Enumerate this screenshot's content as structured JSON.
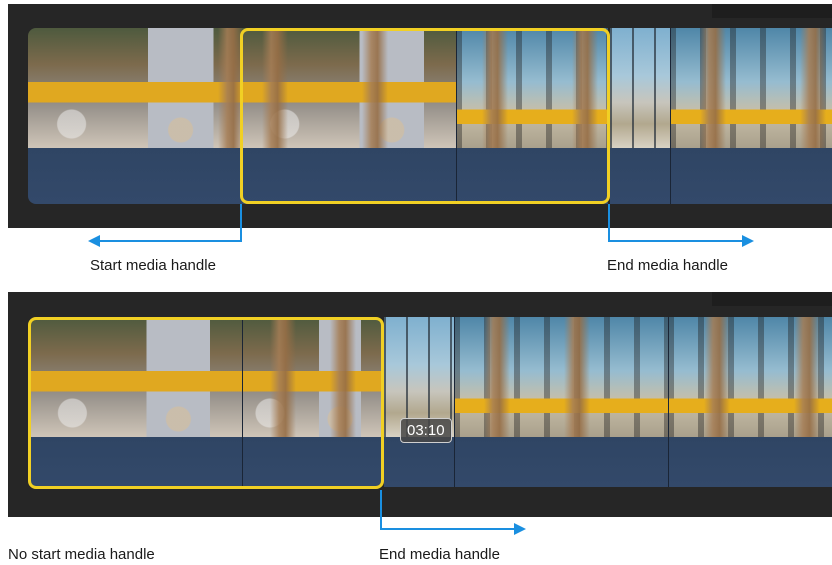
{
  "top_example": {
    "start_handle_label": "Start media handle",
    "end_handle_label": "End media handle"
  },
  "bottom_example": {
    "timecode": "03:10",
    "start_handle_label": "No start media handle",
    "end_handle_label": "End media handle"
  },
  "colors": {
    "selection": "#f1d024",
    "handle_marker": "#1a8fe0",
    "timeline_background": "#262626",
    "clip_track": "#2f4564"
  }
}
